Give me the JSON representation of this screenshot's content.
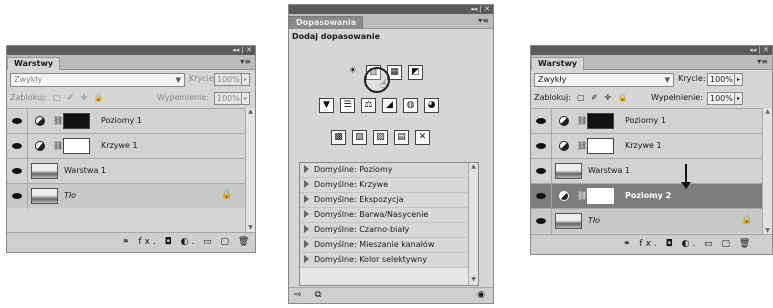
{
  "left_panel": {
    "title_controls": "◂◂ | ✕",
    "tab": "Warstwy",
    "blend_mode": "Zwykły",
    "opacity_label": "Krycie:",
    "opacity_value": "100%",
    "lock_label": "Zablokuj:",
    "fill_label": "Wypełnienie:",
    "fill_value": "100%",
    "layers": [
      {
        "name": "Poziomy 1",
        "type": "adjustment"
      },
      {
        "name": "Krzywe 1",
        "type": "adjustment"
      },
      {
        "name": "Warstwa 1",
        "type": "pixel"
      },
      {
        "name": "Tło",
        "type": "background",
        "locked": true
      }
    ],
    "footer_icons": "⚭ fx. ◘ ◐. ▭ ▢ 🗑"
  },
  "middle_panel": {
    "title_controls": "◂◂ | ✕",
    "tab": "Dopasowania",
    "heading": "Dodaj dopasowanie",
    "icon_row_1": [
      "☀",
      "▥",
      "▦",
      "◩"
    ],
    "icon_row_2": [
      "▼",
      "☰",
      "⚖",
      "◢",
      "◍",
      "◕"
    ],
    "icon_row_3": [
      "▩",
      "▨",
      "▧",
      "▤",
      "✕"
    ],
    "presets": [
      "Domyślne: Poziomy",
      "Domyślne: Krzywe",
      "Domyślne: Ekspozycja",
      "Domyślne: Barwa/Nasycenie",
      "Domyślne: Czarno-biały",
      "Domyślne: Mieszanie kanałów",
      "Domyślne: Kolor selektywny"
    ]
  },
  "right_panel": {
    "title_controls": "◂◂ | ✕",
    "tab": "Warstwy",
    "blend_mode": "Zwykły",
    "opacity_label": "Krycie:",
    "opacity_value": "100%",
    "lock_label": "Zablokuj:",
    "fill_label": "Wypełnienie:",
    "fill_value": "100%",
    "layers": [
      {
        "name": "Poziomy 1",
        "type": "adjustment"
      },
      {
        "name": "Krzywe 1",
        "type": "adjustment"
      },
      {
        "name": "Warstwa 1",
        "type": "pixel"
      },
      {
        "name": "Poziomy 2",
        "type": "adjustment",
        "selected": true
      },
      {
        "name": "Tło",
        "type": "background",
        "locked": true
      }
    ],
    "footer_icons": "⚭ fx. ◘ ◐. ▭ ▢ 🗑"
  }
}
